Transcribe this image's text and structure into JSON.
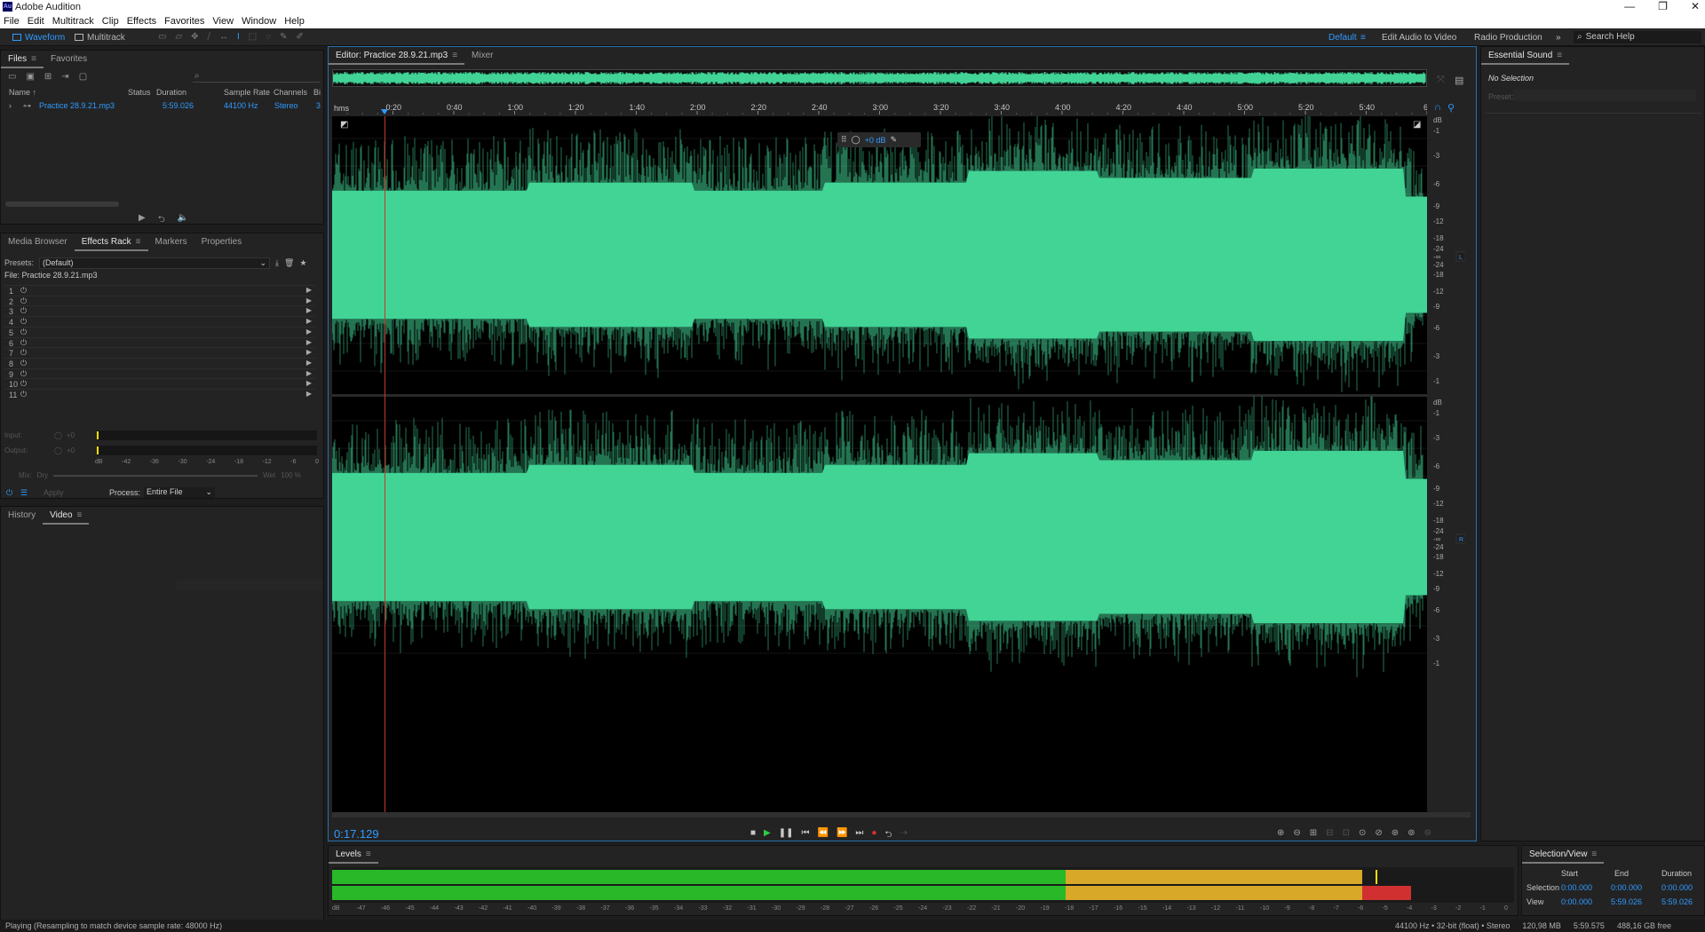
{
  "app": {
    "title": "Adobe Audition",
    "icon": "Au",
    "window_controls": [
      "—",
      "❐",
      "✕"
    ]
  },
  "menu": [
    "File",
    "Edit",
    "Multitrack",
    "Clip",
    "Effects",
    "Favorites",
    "View",
    "Window",
    "Help"
  ],
  "toolbar": {
    "waveform": "Waveform",
    "multitrack": "Multitrack",
    "workspaces": {
      "default": "Default",
      "edit_audio_video": "Edit Audio to Video",
      "radio": "Radio Production",
      "more": "»"
    },
    "search_placeholder": "Search Help"
  },
  "files": {
    "tabs": [
      "Files",
      "Favorites"
    ],
    "search_placeholder": "⌕",
    "columns": {
      "name": "Name ↑",
      "status": "Status",
      "duration": "Duration",
      "sample_rate": "Sample Rate",
      "channels": "Channels",
      "bit": "Bi"
    },
    "rows": [
      {
        "name": "Practice 28.9.21.mp3",
        "duration": "5:59.026",
        "sample_rate": "44100 Hz",
        "channels": "Stereo",
        "bit": "3"
      }
    ]
  },
  "effects": {
    "tabs": [
      "Media Browser",
      "Effects Rack",
      "Markers",
      "Properties"
    ],
    "presets_label": "Presets:",
    "preset_value": "(Default)",
    "file_label": "File: Practice 28.9.21.mp3",
    "slots": [
      "1",
      "2",
      "3",
      "4",
      "5",
      "6",
      "7",
      "8",
      "9",
      "10",
      "11"
    ],
    "input_label": "Input:",
    "output_label": "Output:",
    "io_value": "+0",
    "scale": [
      "dB",
      "-42",
      "-36",
      "-30",
      "-24",
      "-18",
      "-12",
      "-6",
      "0"
    ],
    "mix_label": "Mix:",
    "dry": "Dry",
    "wet": "Wet",
    "wet_pct": "100 %",
    "apply": "Apply",
    "process_label": "Process:",
    "process_value": "Entire File"
  },
  "history": {
    "tabs": [
      "History",
      "Video"
    ]
  },
  "editor": {
    "tabs": [
      "Editor: Practice 28.9.21.mp3",
      "Mixer"
    ],
    "ruler_unit": "hms",
    "ruler_labels": [
      "0:20",
      "0:40",
      "1:00",
      "1:20",
      "1:40",
      "2:00",
      "2:20",
      "2:40",
      "3:00",
      "3:20",
      "3:40",
      "4:00",
      "4:20",
      "4:40",
      "5:00",
      "5:20",
      "5:40",
      "6"
    ],
    "db_labels_top": [
      "dB",
      "-1",
      "-3",
      "-6",
      "-9",
      "-12",
      "-18",
      "-24",
      "-∞",
      "-24",
      "-18",
      "-12",
      "-9",
      "-6",
      "-3",
      "-1"
    ],
    "db_labels_bottom": [
      "dB",
      "-1",
      "-3",
      "-6",
      "-9",
      "-12",
      "-18",
      "-24",
      "-∞",
      "-24",
      "-18",
      "-12",
      "-9",
      "-6",
      "-3",
      "-1"
    ],
    "channel_top": "L",
    "channel_bottom": "R",
    "hud_value": "+0 dB",
    "timecode": "0:17.129",
    "playhead_time_s": 17.129,
    "total_duration_s": 359.026,
    "waveform_color": "#41d496"
  },
  "essential_sound": {
    "title": "Essential Sound",
    "no_selection": "No Selection",
    "preset_label": "Preset:"
  },
  "levels": {
    "title": "Levels",
    "scale": [
      "dB",
      "-47",
      "-46",
      "-45",
      "-44",
      "-43",
      "-42",
      "-41",
      "-40",
      "-39",
      "-38",
      "-37",
      "-36",
      "-35",
      "-34",
      "-33",
      "-32",
      "-31",
      "-30",
      "-29",
      "-28",
      "-27",
      "-26",
      "-25",
      "-24",
      "-23",
      "-22",
      "-21",
      "-20",
      "-19",
      "-18",
      "-17",
      "-16",
      "-15",
      "-14",
      "-13",
      "-12",
      "-11",
      "-10",
      "-9",
      "-8",
      "-7",
      "-6",
      "-5",
      "-4",
      "-3",
      "-2",
      "-1",
      "0"
    ],
    "colors": {
      "green": "#28b828",
      "yellow": "#d8a828",
      "red": "#d03030"
    }
  },
  "selection_view": {
    "title": "Selection/View",
    "headers": [
      "Start",
      "End",
      "Duration"
    ],
    "selection_label": "Selection",
    "view_label": "View",
    "selection": [
      "0:00.000",
      "0:00.000",
      "0:00.000"
    ],
    "view": [
      "0:00.000",
      "5:59.026",
      "5:59.026"
    ]
  },
  "status": {
    "left": "Playing (Resampling to match device sample rate: 48000 Hz)",
    "format": "44100 Hz • 32-bit (float) • Stereo",
    "size": "120,98 MB",
    "duration": "5:59.575",
    "free": "488,16 GB free"
  }
}
